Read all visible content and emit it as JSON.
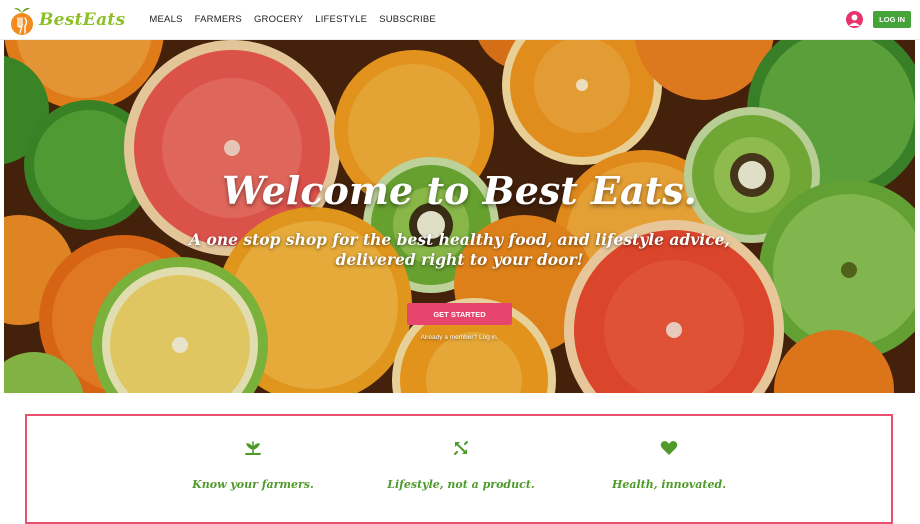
{
  "brand": {
    "name": "BestEats"
  },
  "nav": {
    "links": [
      "MEALS",
      "FARMERS",
      "GROCERY",
      "LIFESTYLE",
      "SUBSCRIBE"
    ],
    "login_label": "LOG IN",
    "user_icon": "user-circle-icon"
  },
  "hero": {
    "title": "Welcome to Best Eats.",
    "subtitle": "A one stop shop for the best healthy food, and lifestyle advice, delivered right to your door!",
    "cta_label": "GET STARTED",
    "member_text": "Already a member? Log in."
  },
  "features": [
    {
      "icon": "sprout-icon",
      "label": "Know your farmers."
    },
    {
      "icon": "arrows-diagonal-icon",
      "label": "Lifestyle, not a product."
    },
    {
      "icon": "heart-icon",
      "label": "Health, innovated."
    }
  ],
  "colors": {
    "brand_green": "#8cbf26",
    "login_green": "#46a33a",
    "accent_pink": "#e8456e",
    "feature_green": "#4e9a2a"
  }
}
